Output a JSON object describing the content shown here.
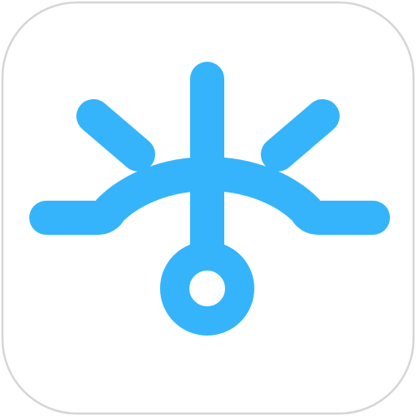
{
  "app_icon": {
    "icon": "helm-gauge-icon",
    "colors": {
      "background": "#ffffff",
      "tile_fill": "#ffffff",
      "tile_border": "#d5d5d5",
      "glyph": "#35b4fc"
    }
  }
}
